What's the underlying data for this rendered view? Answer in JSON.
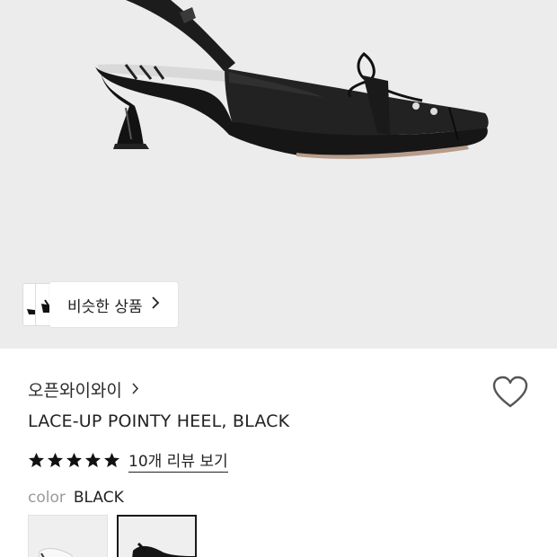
{
  "colors": {
    "hero_background": "#ececec",
    "text_primary": "#222222",
    "text_muted": "#9a9a9a",
    "star": "#111111",
    "selected_border": "#1a1a1a"
  },
  "hero": {
    "image": "black-lace-up-pointy-slingback-heel",
    "similar_products_label": "비슷한 상품",
    "similar_products_icon": "chevron-right-icon"
  },
  "product": {
    "brand": "오픈와이와이",
    "brand_icon": "chevron-right-icon",
    "name": "LACE-UP POINTY HEEL, BLACK",
    "wishlist_icon": "heart-outline-icon",
    "rating_stars": 5,
    "review_link": "10개 리뷰 보기"
  },
  "options": {
    "color_label": "color",
    "color_value": "BLACK",
    "swatches": [
      {
        "variant": "white-heel-thumbnail",
        "selected": false
      },
      {
        "variant": "black-heel-thumbnail",
        "selected": true
      }
    ]
  }
}
